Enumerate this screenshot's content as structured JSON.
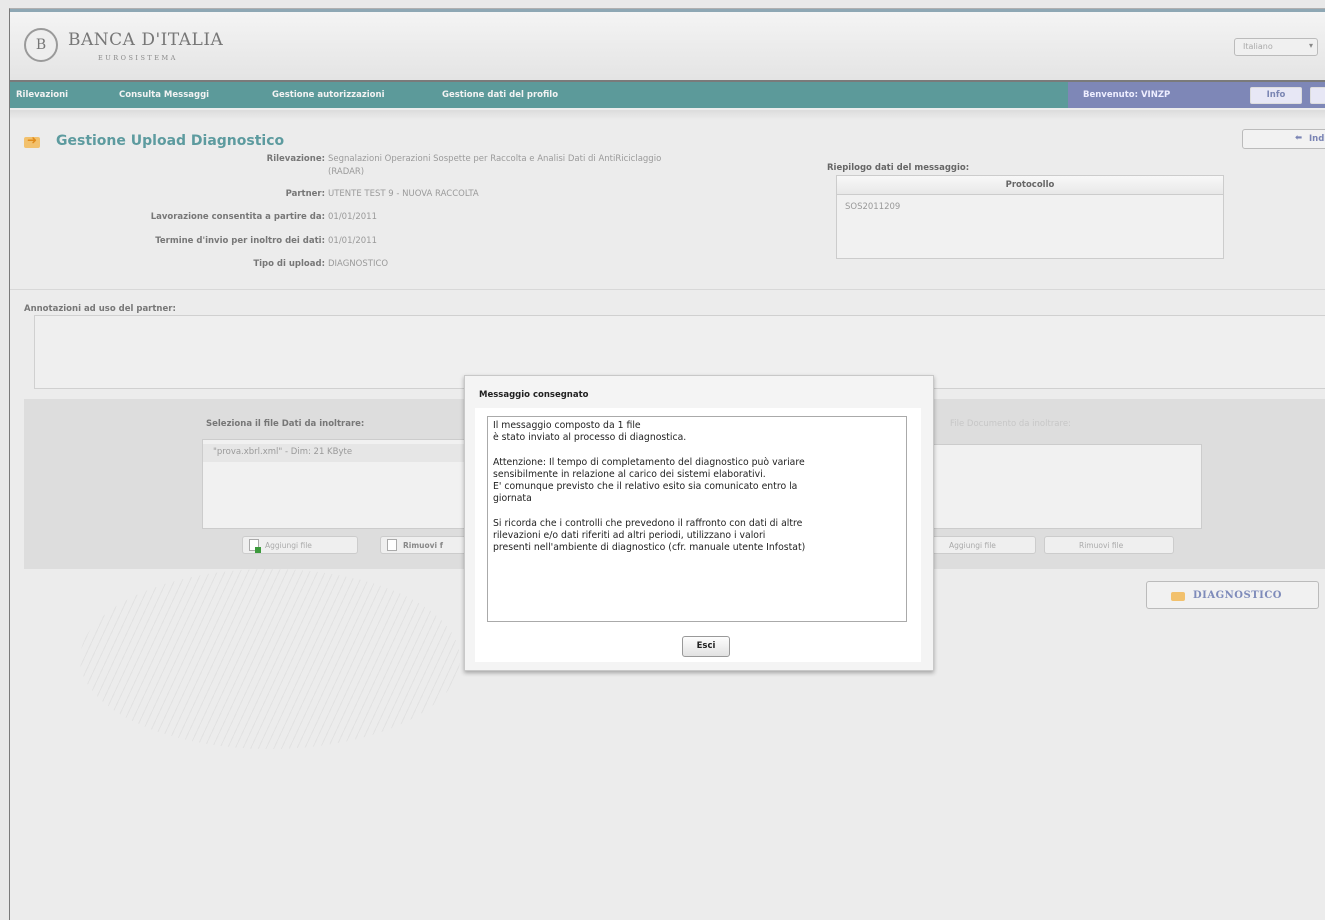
{
  "header": {
    "logo_emblem": "B",
    "logo_title": "BANCA D'ITALIA",
    "logo_subtitle": "EUROSISTEMA",
    "language": "Italiano"
  },
  "nav": {
    "items": [
      "Rilevazioni",
      "Consulta Messaggi",
      "Gestione autorizzazioni",
      "Gestione dati del profilo"
    ],
    "welcome": "Benvenuto:  VINZP",
    "info_label": "Info"
  },
  "page": {
    "title": "Gestione Upload Diagnostico",
    "back_label": "Indie"
  },
  "details": [
    {
      "label": "Rilevazione:",
      "value": "Segnalazioni Operazioni Sospette per Raccolta e Analisi Dati di AntiRiciclaggio"
    },
    {
      "label": "",
      "value": "(RADAR)"
    },
    {
      "label": "Partner:",
      "value": "UTENTE TEST 9 - NUOVA RACCOLTA"
    },
    {
      "label": "Lavorazione consentita a partire da:",
      "value": "01/01/2011"
    },
    {
      "label": "Termine d'invio per inoltro dei dati:",
      "value": "01/01/2011"
    },
    {
      "label": "Tipo di upload:",
      "value": "DIAGNOSTICO"
    }
  ],
  "riepilogo": {
    "title": "Riepilogo dati del messaggio:",
    "column": "Protocollo",
    "value": "SOS2011209"
  },
  "annotazioni": {
    "label": "Annotazioni ad uso del partner:"
  },
  "upload": {
    "left_label": "Seleziona il file Dati da inoltrare:",
    "left_item": "\"prova.xbrl.xml\" - Dim: 21 KByte",
    "add_label": "Aggiungi file",
    "remove_label": "Rimuovi f",
    "right_label": "File Documento da inoltrare:",
    "right_add_label": "Aggiungi file",
    "right_remove_label": "Rimuovi file"
  },
  "diagnostico_label": "DIAGNOSTICO",
  "dialog": {
    "title": "Messaggio consegnato",
    "text": "Il messaggio composto da 1 file\nè stato inviato al processo di diagnostica.\n\nAttenzione: Il tempo di completamento del diagnostico può variare\nsensibilmente in relazione al carico dei sistemi elaborativi.\nE' comunque previsto che il relativo esito sia comunicato entro la\ngiornata\n\nSi ricorda che i controlli che prevedono il raffronto con dati di altre\nrilevazioni e/o dati riferiti ad altri periodi, utilizzano i valori\npresenti nell'ambiente di diagnostico (cfr. manuale utente Infostat)",
    "exit_label": "Esci"
  }
}
